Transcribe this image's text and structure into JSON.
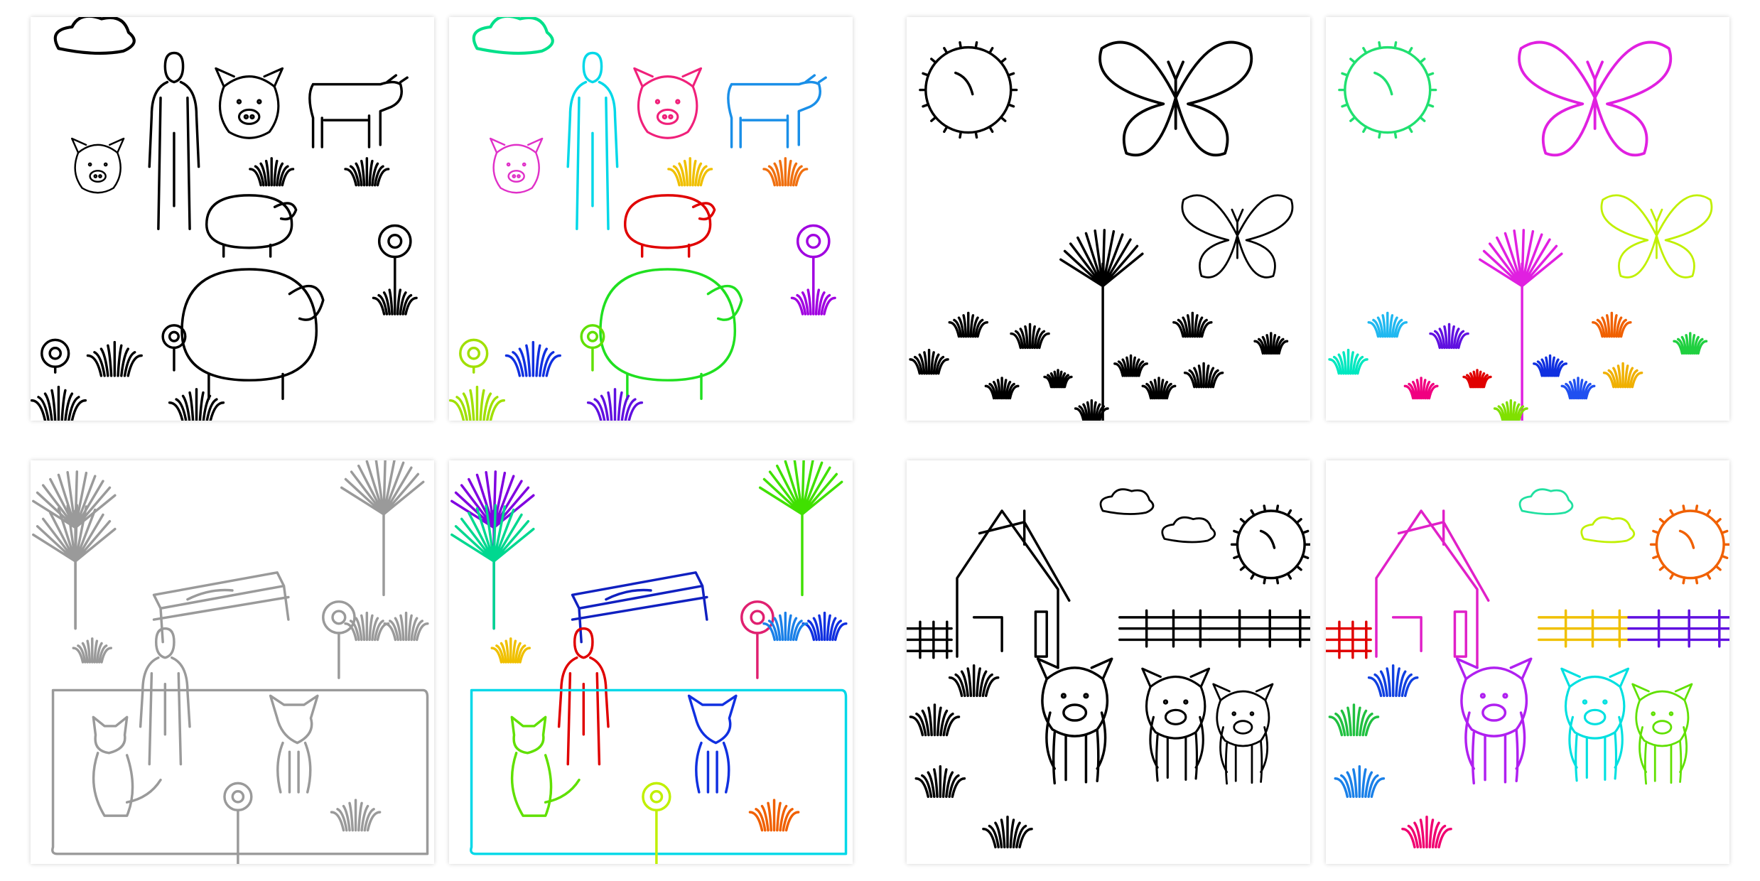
{
  "figure": {
    "panels": [
      {
        "scene": "farm-animals",
        "mode": "sketch",
        "ink": "#000000"
      },
      {
        "scene": "farm-animals",
        "mode": "segmented"
      },
      {
        "scene": "butterflies",
        "mode": "sketch",
        "ink": "#000000"
      },
      {
        "scene": "butterflies",
        "mode": "segmented"
      },
      {
        "scene": "park",
        "mode": "sketch",
        "ink": "#9a9a9a"
      },
      {
        "scene": "park",
        "mode": "segmented"
      },
      {
        "scene": "house-pigs",
        "mode": "sketch",
        "ink": "#000000"
      },
      {
        "scene": "house-pigs",
        "mode": "segmented"
      }
    ],
    "segment_colors": {
      "farm-animals": [
        "#00e08a",
        "#00d8e8",
        "#f0207a",
        "#1a8fe8",
        "#e030c8",
        "#f0c000",
        "#f07010",
        "#e00000",
        "#20e020",
        "#a000e0",
        "#a0e000",
        "#1030e0",
        "#60e000",
        "#6010e0"
      ],
      "butterflies": [
        "#20e070",
        "#e020e0",
        "#c0f000",
        "#20b8f0",
        "#00e8c0",
        "#6010e0",
        "#f06000",
        "#20d040",
        "#f00080",
        "#e00000",
        "#f0b000",
        "#2050f0",
        "#80e000",
        "#1030e0"
      ],
      "park": [
        "#8000e0",
        "#00d890",
        "#40e000",
        "#1020c0",
        "#f0c000",
        "#e00000",
        "#e02070",
        "#00d8e8",
        "#60e000",
        "#1030e0",
        "#c0f000",
        "#f06000",
        "#1a80e8"
      ],
      "house-pigs": [
        "#e020c8",
        "#20e0a0",
        "#c0f000",
        "#f06000",
        "#e00000",
        "#f0c000",
        "#6010e0",
        "#1040e0",
        "#20c040",
        "#1a80e8",
        "#b020f0",
        "#00e0e0",
        "#60e000",
        "#f00070"
      ]
    }
  }
}
